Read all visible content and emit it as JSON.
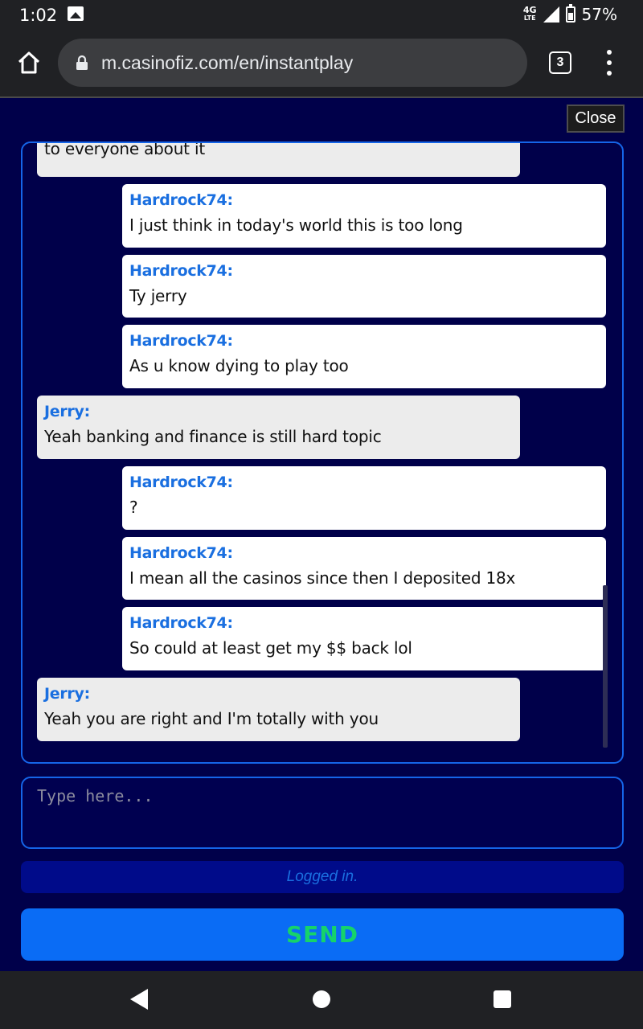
{
  "status_bar": {
    "time": "1:02",
    "network": "4G",
    "network_sub": "LTE",
    "battery": "57%",
    "icons": [
      "image-notification-icon",
      "signal-icon",
      "battery-icon"
    ]
  },
  "browser": {
    "url": "m.casinofiz.com/en/instantplay",
    "tab_count": "3"
  },
  "close_label": "Close",
  "chat": {
    "partial_text": "to everyone about it",
    "messages": [
      {
        "side": "right",
        "name": "Hardrock74:",
        "text": "I just think in today's world this is too long"
      },
      {
        "side": "right",
        "name": "Hardrock74:",
        "text": "Ty jerry"
      },
      {
        "side": "right",
        "name": "Hardrock74:",
        "text": "As u know dying to play too"
      },
      {
        "side": "left",
        "name": "Jerry:",
        "text": "Yeah banking and finance is still hard topic"
      },
      {
        "side": "right",
        "name": "Hardrock74:",
        "text": "?"
      },
      {
        "side": "right",
        "name": "Hardrock74:",
        "text": "I mean all the casinos since then I deposited 18x"
      },
      {
        "side": "right",
        "name": "Hardrock74:",
        "text": "So could at least get my $$ back lol"
      },
      {
        "side": "left",
        "name": "Jerry:",
        "text": "Yeah you are right and I'm totally with you"
      }
    ]
  },
  "input": {
    "placeholder": "Type here...",
    "value": ""
  },
  "status_message": "Logged in.",
  "send_label": "SEND",
  "colors": {
    "background": "#00004a",
    "accent": "#1565e8",
    "username": "#1a6fe0",
    "send_text": "#16d36a"
  }
}
